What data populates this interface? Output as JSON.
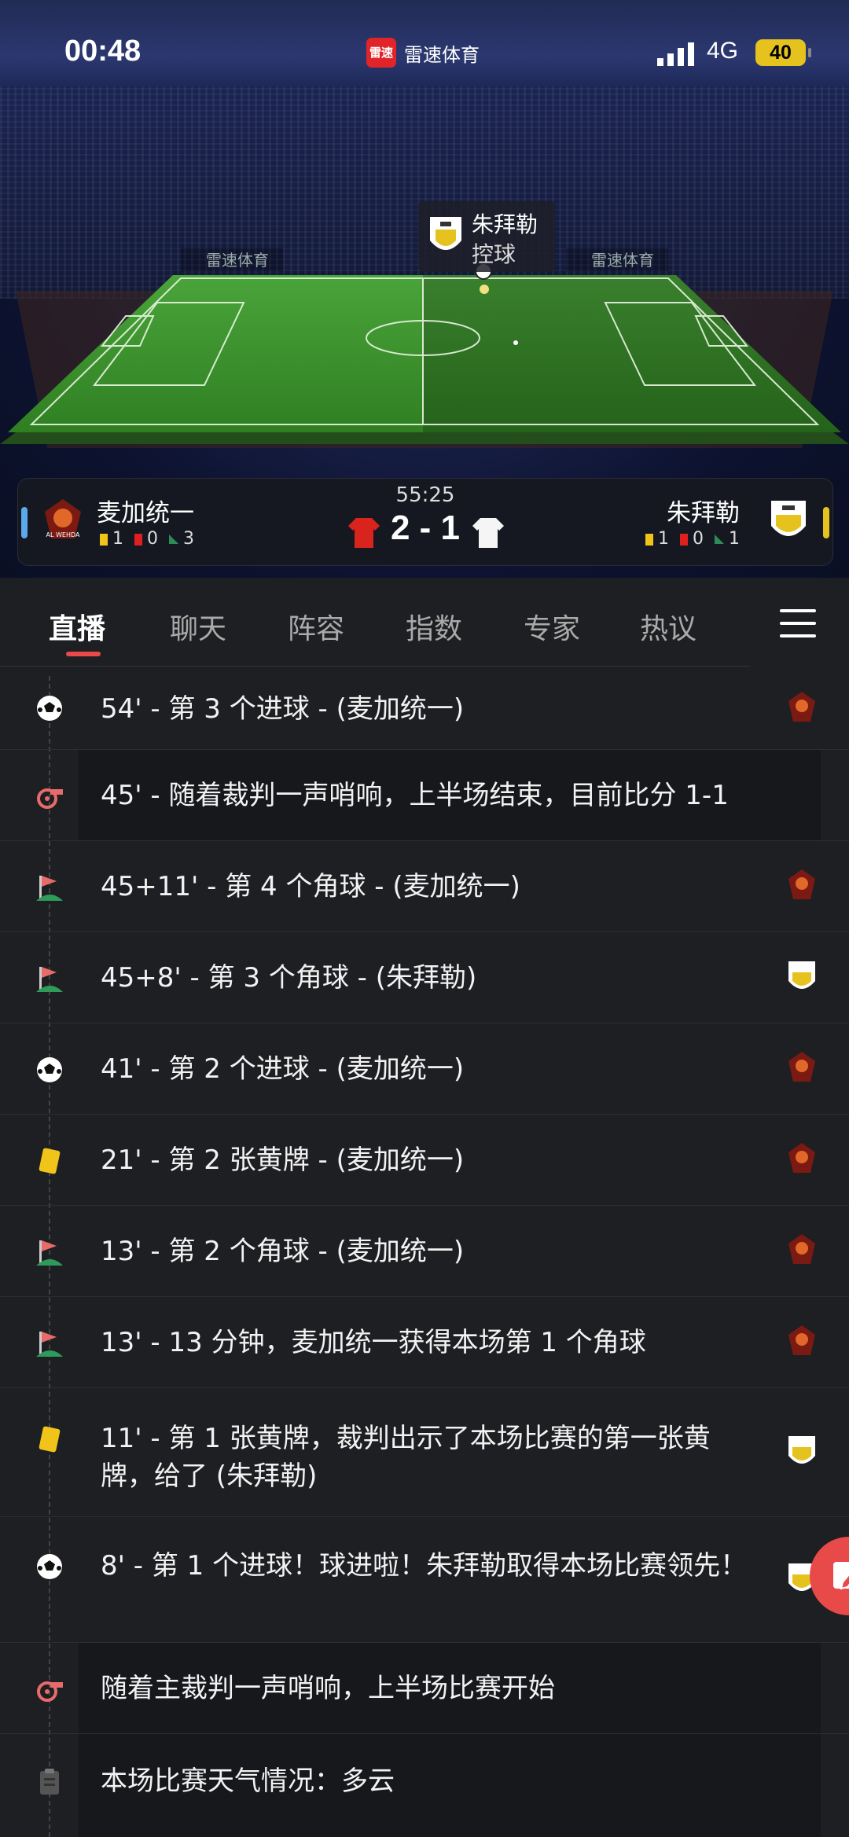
{
  "status_bar": {
    "time": "00:48",
    "app_logo_text": "雷速",
    "app_name": "雷速体育",
    "network": "4G",
    "battery": "40"
  },
  "field": {
    "possession_team": "朱拜勒",
    "possession_label": "控球",
    "ads": [
      "雷速体育",
      "雷速体育",
      "雷速体育"
    ]
  },
  "match": {
    "time": "55:25",
    "score": "2 - 1",
    "home": {
      "name": "麦加统一",
      "badge_text": "AL WEHDA",
      "yellow": "1",
      "red": "0",
      "corners": "3"
    },
    "away": {
      "name": "朱拜勒",
      "yellow": "1",
      "red": "0",
      "corners": "1"
    }
  },
  "tabs": [
    "直播",
    "聊天",
    "阵容",
    "指数",
    "专家",
    "热议"
  ],
  "events": [
    {
      "icon": "football-icon",
      "text": "54' - 第 3 个进球 - (麦加统一)",
      "team": "home"
    },
    {
      "icon": "whistle-icon",
      "text": "45' - 随着裁判一声哨响，上半场结束，目前比分 1-1",
      "team": ""
    },
    {
      "icon": "corner-flag-icon",
      "text": "45+11' - 第 4 个角球 - (麦加统一)",
      "team": "home"
    },
    {
      "icon": "corner-flag-icon",
      "text": "45+8' - 第 3 个角球 - (朱拜勒)",
      "team": "away"
    },
    {
      "icon": "football-icon",
      "text": "41' - 第 2 个进球 - (麦加统一)",
      "team": "home"
    },
    {
      "icon": "yellow-card-icon",
      "text": "21' - 第 2 张黄牌 - (麦加统一)",
      "team": "home"
    },
    {
      "icon": "corner-flag-icon",
      "text": "13' - 第 2 个角球 - (麦加统一)",
      "team": "home"
    },
    {
      "icon": "corner-flag-icon",
      "text": "13' - 13 分钟，麦加统一获得本场第 1 个角球",
      "team": "home"
    },
    {
      "icon": "yellow-card-icon",
      "text": "11' - 第 1 张黄牌，裁判出示了本场比赛的第一张黄牌，给了 (朱拜勒)",
      "team": "away"
    },
    {
      "icon": "football-icon",
      "text": "8' - 第 1 个进球！球进啦！朱拜勒取得本场比赛领先！",
      "team": "away"
    },
    {
      "icon": "whistle-icon",
      "text": "随着主裁判一声哨响，上半场比赛开始",
      "team": ""
    },
    {
      "icon": "clipboard-icon",
      "text": "本场比赛天气情况：多云",
      "team": ""
    }
  ],
  "colors": {
    "accent": "#e84a4a",
    "home_strip": "#5aa9ea",
    "away_strip": "#e5c21d",
    "pitch": "#3f9a2f"
  }
}
